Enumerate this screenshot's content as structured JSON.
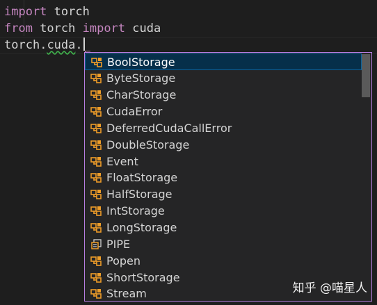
{
  "code": {
    "line1": {
      "kw": "import",
      "rest": " torch"
    },
    "line2": {
      "kw1": "from",
      "mid": " torch ",
      "kw2": "import",
      "rest": " cuda"
    },
    "line3": {
      "obj": "torch",
      "dot1": ".",
      "mod": "cuda",
      "dot2": "."
    }
  },
  "suggestions": [
    {
      "label": "BoolStorage",
      "icon": "class-icon",
      "selected": true
    },
    {
      "label": "ByteStorage",
      "icon": "class-icon"
    },
    {
      "label": "CharStorage",
      "icon": "class-icon"
    },
    {
      "label": "CudaError",
      "icon": "class-icon"
    },
    {
      "label": "DeferredCudaCallError",
      "icon": "class-icon"
    },
    {
      "label": "DoubleStorage",
      "icon": "class-icon"
    },
    {
      "label": "Event",
      "icon": "class-icon"
    },
    {
      "label": "FloatStorage",
      "icon": "class-icon"
    },
    {
      "label": "HalfStorage",
      "icon": "class-icon"
    },
    {
      "label": "IntStorage",
      "icon": "class-icon"
    },
    {
      "label": "LongStorage",
      "icon": "class-icon"
    },
    {
      "label": "PIPE",
      "icon": "constant-icon"
    },
    {
      "label": "Popen",
      "icon": "class-icon"
    },
    {
      "label": "ShortStorage",
      "icon": "class-icon"
    },
    {
      "label": "Stream",
      "icon": "class-icon"
    }
  ],
  "colors": {
    "keyword": "#c586c0",
    "class_icon": "#ee9d28",
    "selection": "#062f4a",
    "widget_border": "#b67de0"
  },
  "watermark": "知乎 @喵星人"
}
